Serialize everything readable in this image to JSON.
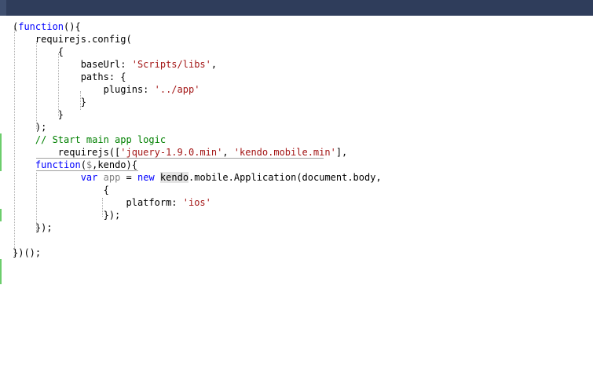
{
  "editor": {
    "lines": [
      [
        {
          "t": "(",
          "c": ""
        },
        {
          "t": "function",
          "c": "kw"
        },
        {
          "t": "(){",
          "c": ""
        }
      ],
      [
        {
          "t": "    requirejs.config(",
          "c": ""
        }
      ],
      [
        {
          "t": "        {",
          "c": ""
        }
      ],
      [
        {
          "t": "            baseUrl: ",
          "c": ""
        },
        {
          "t": "'Scripts/libs'",
          "c": "str"
        },
        {
          "t": ",",
          "c": ""
        }
      ],
      [
        {
          "t": "            paths: {",
          "c": ""
        }
      ],
      [
        {
          "t": "                plugins: ",
          "c": ""
        },
        {
          "t": "'../app'",
          "c": "str"
        }
      ],
      [
        {
          "t": "            }",
          "c": ""
        }
      ],
      [
        {
          "t": "        }",
          "c": ""
        }
      ],
      [
        {
          "t": "    );",
          "c": ""
        }
      ],
      [
        {
          "t": "    ",
          "c": ""
        },
        {
          "t": "// Start main app logic",
          "c": "com"
        }
      ],
      [
        {
          "t": "        requirejs([",
          "c": ""
        },
        {
          "t": "'jquery-1.9.0.min'",
          "c": "str"
        },
        {
          "t": ", ",
          "c": ""
        },
        {
          "t": "'kendo.mobile.min'",
          "c": "str"
        },
        {
          "t": "],",
          "c": ""
        }
      ],
      [
        {
          "t": "    ",
          "c": ""
        },
        {
          "t": "function",
          "c": "kw"
        },
        {
          "t": "(",
          "c": ""
        },
        {
          "t": "$",
          "c": "param"
        },
        {
          "t": ",kendo){",
          "c": ""
        }
      ],
      [
        {
          "t": "            ",
          "c": ""
        },
        {
          "t": "var",
          "c": "kw"
        },
        {
          "t": " ",
          "c": ""
        },
        {
          "t": "app",
          "c": "param"
        },
        {
          "t": " = ",
          "c": ""
        },
        {
          "t": "new",
          "c": "kw"
        },
        {
          "t": " ",
          "c": ""
        },
        {
          "t": "kendo",
          "c": "hl"
        },
        {
          "t": ".mobile.Application(document.body,",
          "c": ""
        }
      ],
      [
        {
          "t": "                {",
          "c": ""
        }
      ],
      [
        {
          "t": "                    platform: ",
          "c": ""
        },
        {
          "t": "'ios'",
          "c": "str"
        }
      ],
      [
        {
          "t": "                });",
          "c": ""
        }
      ],
      [
        {
          "t": "    });",
          "c": ""
        }
      ],
      [
        {
          "t": "",
          "c": ""
        }
      ],
      [
        {
          "t": "})();",
          "c": ""
        }
      ]
    ]
  }
}
